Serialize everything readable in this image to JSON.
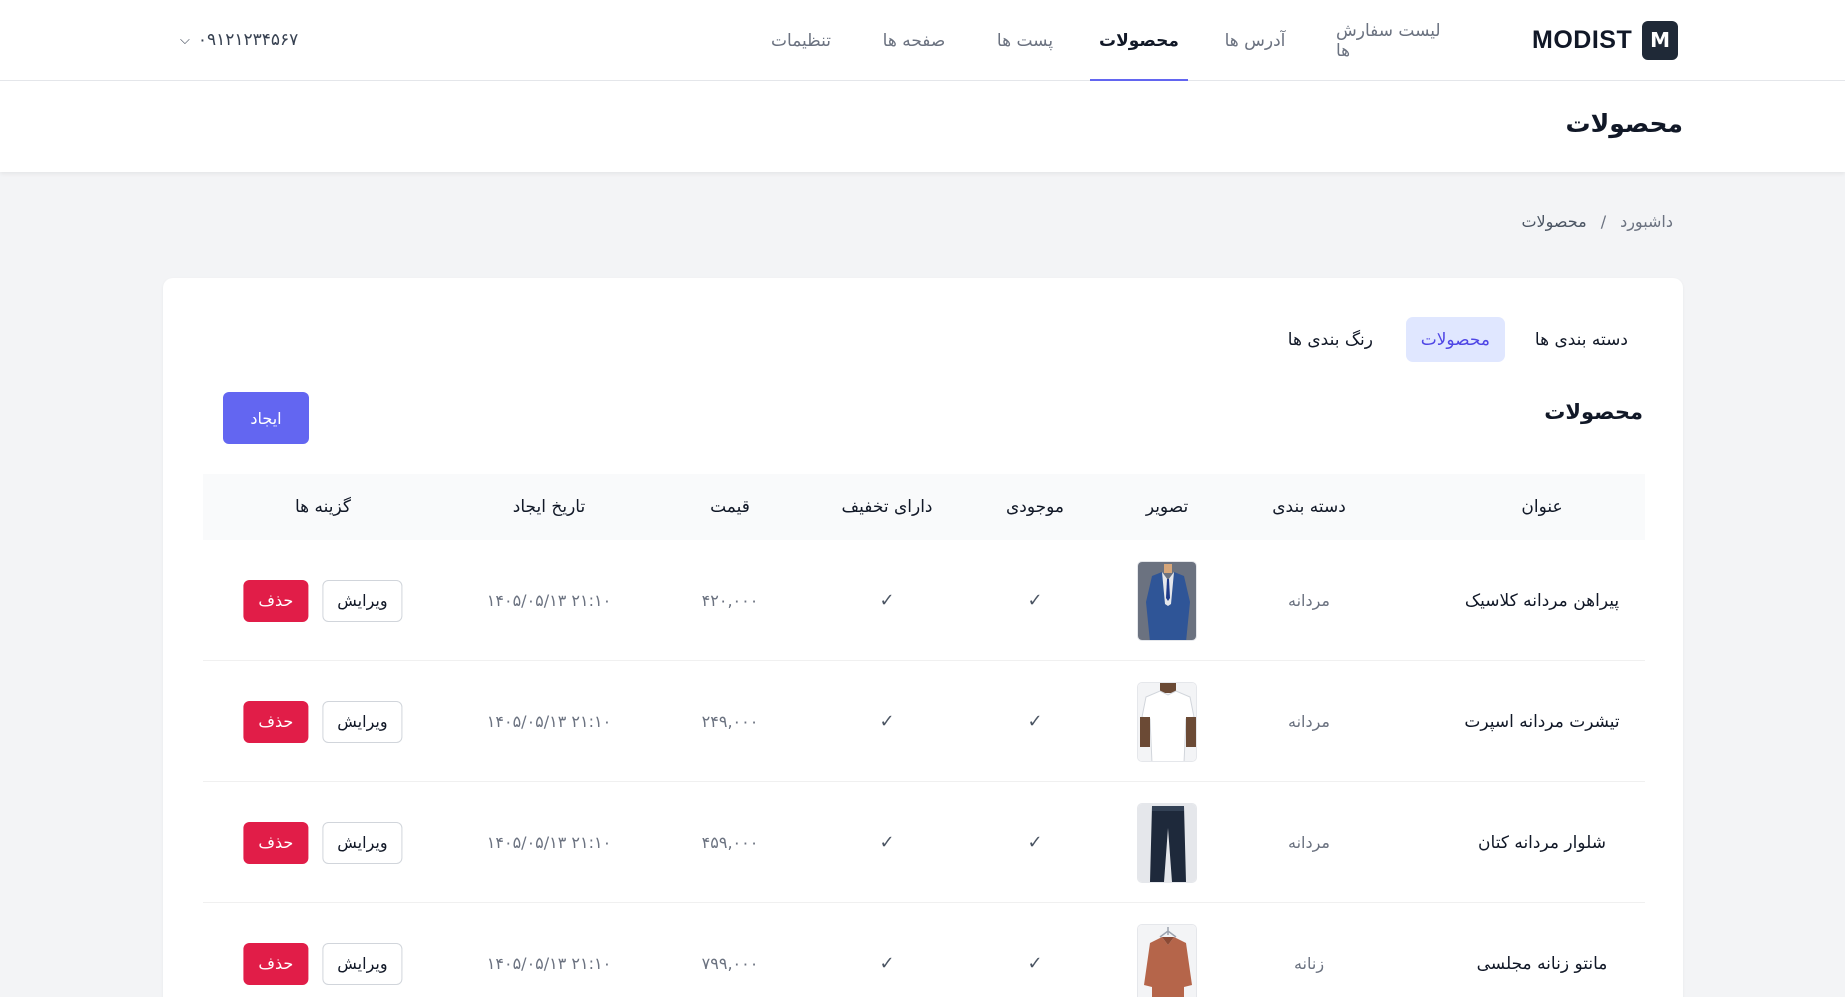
{
  "header": {
    "logo_letter": "M",
    "logo_text": "MODIST",
    "nav": [
      {
        "label": "لیست سفارش ها",
        "active": false
      },
      {
        "label": "آدرس ها",
        "active": false
      },
      {
        "label": "محصولات",
        "active": true
      },
      {
        "label": "پست ها",
        "active": false
      },
      {
        "label": "صفحه ها",
        "active": false
      },
      {
        "label": "تنظیمات",
        "active": false
      }
    ],
    "user_phone": "۰۹۱۲۱۲۳۴۵۶۷"
  },
  "page": {
    "title": "محصولات"
  },
  "breadcrumb": {
    "items": [
      "داشبورد",
      "محصولات"
    ],
    "separator": "/"
  },
  "card": {
    "tabs": [
      {
        "label": "دسته بندی ها",
        "active": false
      },
      {
        "label": "محصولات",
        "active": true
      },
      {
        "label": "رنگ بندی ها",
        "active": false
      }
    ],
    "section_title": "محصولات",
    "create_label": "ایجاد"
  },
  "table": {
    "columns": [
      "عنوان",
      "دسته بندی",
      "تصویر",
      "موجودی",
      "دارای تخفیف",
      "قیمت",
      "تاریخ ایجاد",
      "گزینه ها"
    ],
    "edit_label": "ویرایش",
    "delete_label": "حذف",
    "rows": [
      {
        "title": "پیراهن مردانه کلاسیک",
        "category": "مردانه",
        "image": "suit",
        "in_stock": true,
        "has_discount": true,
        "price": "۴۲۰,۰۰۰",
        "created": "۱۴۰۵/۰۵/۱۳ ۲۱:۱۰"
      },
      {
        "title": "تیشرت مردانه اسپرت",
        "category": "مردانه",
        "image": "tshirt",
        "in_stock": true,
        "has_discount": true,
        "price": "۲۴۹,۰۰۰",
        "created": "۱۴۰۵/۰۵/۱۳ ۲۱:۱۰"
      },
      {
        "title": "شلوار مردانه کتان",
        "category": "مردانه",
        "image": "pants",
        "in_stock": true,
        "has_discount": true,
        "price": "۴۵۹,۰۰۰",
        "created": "۱۴۰۵/۰۵/۱۳ ۲۱:۱۰"
      },
      {
        "title": "مانتو زنانه مجلسی",
        "category": "زنانه",
        "image": "coat",
        "in_stock": true,
        "has_discount": true,
        "price": "۷۹۹,۰۰۰",
        "created": "۱۴۰۵/۰۵/۱۳ ۲۱:۱۰"
      }
    ]
  },
  "colors": {
    "accent": "#6366f1",
    "accent_light": "#e0e7ff",
    "danger": "#e11d48"
  }
}
